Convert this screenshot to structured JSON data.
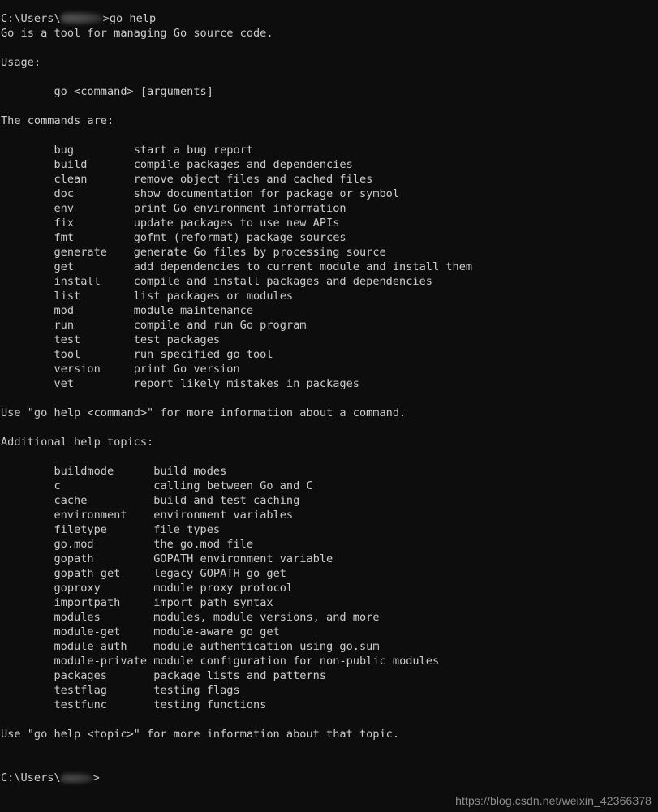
{
  "window": {
    "app": "Command Prompt",
    "background_color": "#0d0d0d",
    "foreground_color": "#cccccc"
  },
  "prompt_top": {
    "path_prefix": "C:\\Users\\",
    "redacted_user": "",
    "suffix": ">",
    "command": "go help"
  },
  "prompt_bottom": {
    "path_prefix": "C:\\Users\\",
    "redacted_user": "",
    "suffix": ">"
  },
  "output": {
    "intro": "Go is a tool for managing Go source code.",
    "usage_label": "Usage:",
    "usage_line": "        go <command> [arguments]",
    "commands_label": "The commands are:",
    "commands": [
      {
        "name": "bug",
        "desc": "start a bug report"
      },
      {
        "name": "build",
        "desc": "compile packages and dependencies"
      },
      {
        "name": "clean",
        "desc": "remove object files and cached files"
      },
      {
        "name": "doc",
        "desc": "show documentation for package or symbol"
      },
      {
        "name": "env",
        "desc": "print Go environment information"
      },
      {
        "name": "fix",
        "desc": "update packages to use new APIs"
      },
      {
        "name": "fmt",
        "desc": "gofmt (reformat) package sources"
      },
      {
        "name": "generate",
        "desc": "generate Go files by processing source"
      },
      {
        "name": "get",
        "desc": "add dependencies to current module and install them"
      },
      {
        "name": "install",
        "desc": "compile and install packages and dependencies"
      },
      {
        "name": "list",
        "desc": "list packages or modules"
      },
      {
        "name": "mod",
        "desc": "module maintenance"
      },
      {
        "name": "run",
        "desc": "compile and run Go program"
      },
      {
        "name": "test",
        "desc": "test packages"
      },
      {
        "name": "tool",
        "desc": "run specified go tool"
      },
      {
        "name": "version",
        "desc": "print Go version"
      },
      {
        "name": "vet",
        "desc": "report likely mistakes in packages"
      }
    ],
    "command_hint": "Use \"go help <command>\" for more information about a command.",
    "topics_label": "Additional help topics:",
    "topics": [
      {
        "name": "buildmode",
        "desc": "build modes"
      },
      {
        "name": "c",
        "desc": "calling between Go and C"
      },
      {
        "name": "cache",
        "desc": "build and test caching"
      },
      {
        "name": "environment",
        "desc": "environment variables"
      },
      {
        "name": "filetype",
        "desc": "file types"
      },
      {
        "name": "go.mod",
        "desc": "the go.mod file"
      },
      {
        "name": "gopath",
        "desc": "GOPATH environment variable"
      },
      {
        "name": "gopath-get",
        "desc": "legacy GOPATH go get"
      },
      {
        "name": "goproxy",
        "desc": "module proxy protocol"
      },
      {
        "name": "importpath",
        "desc": "import path syntax"
      },
      {
        "name": "modules",
        "desc": "modules, module versions, and more"
      },
      {
        "name": "module-get",
        "desc": "module-aware go get"
      },
      {
        "name": "module-auth",
        "desc": "module authentication using go.sum"
      },
      {
        "name": "module-private",
        "desc": "module configuration for non-public modules"
      },
      {
        "name": "packages",
        "desc": "package lists and patterns"
      },
      {
        "name": "testflag",
        "desc": "testing flags"
      },
      {
        "name": "testfunc",
        "desc": "testing functions"
      }
    ],
    "topic_hint": "Use \"go help <topic>\" for more information about that topic."
  },
  "watermark": {
    "text": "https://blog.csdn.net/weixin_42366378"
  }
}
